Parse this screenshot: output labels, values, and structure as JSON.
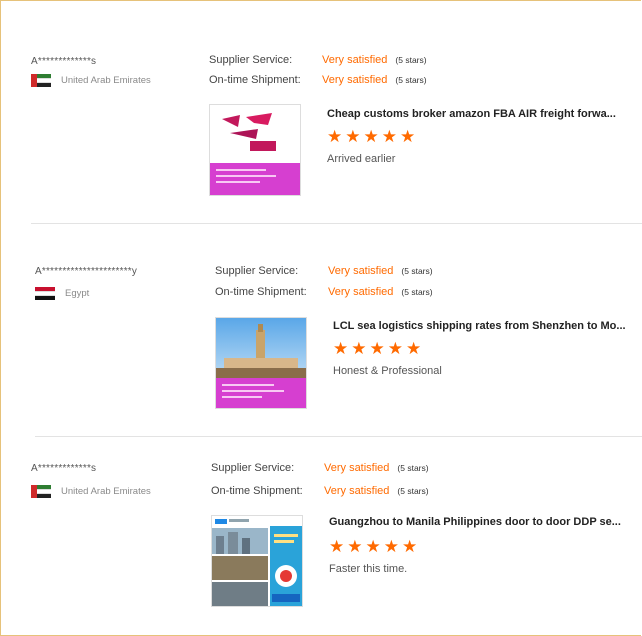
{
  "reviews": [
    {
      "buyer": "A*************s",
      "country": "United Arab Emirates",
      "flag": "uae-flag",
      "supplier_service_label": "Supplier Service:",
      "supplier_service_value": "Very satisfied",
      "supplier_service_stars": "(5 stars)",
      "shipment_label": "On-time Shipment:",
      "shipment_value": "Very satisfied",
      "shipment_stars": "(5 stars)",
      "product_title": "Cheap customs broker amazon FBA AIR freight forwa...",
      "rating": 5,
      "comment": "Arrived earlier"
    },
    {
      "buyer": "A**********************y",
      "country": "Egypt",
      "flag": "egypt-flag",
      "supplier_service_label": "Supplier Service:",
      "supplier_service_value": "Very satisfied",
      "supplier_service_stars": "(5 stars)",
      "shipment_label": "On-time Shipment:",
      "shipment_value": "Very satisfied",
      "shipment_stars": "(5 stars)",
      "product_title": "LCL sea logistics shipping rates from Shenzhen to Mo...",
      "rating": 5,
      "comment": "Honest & Professional"
    },
    {
      "buyer": "A*************s",
      "country": "United Arab Emirates",
      "flag": "uae-flag",
      "supplier_service_label": "Supplier Service:",
      "supplier_service_value": "Very satisfied",
      "supplier_service_stars": "(5 stars)",
      "shipment_label": "On-time Shipment:",
      "shipment_value": "Very satisfied",
      "shipment_stars": "(5 stars)",
      "product_title": "Guangzhou to Manila Philippines door to door DDP se...",
      "rating": 5,
      "comment": "Faster this time."
    }
  ],
  "colors": {
    "accent": "#ff6a00",
    "frame": "#e6c27a",
    "thumb_magenta": "#d63fd0"
  }
}
